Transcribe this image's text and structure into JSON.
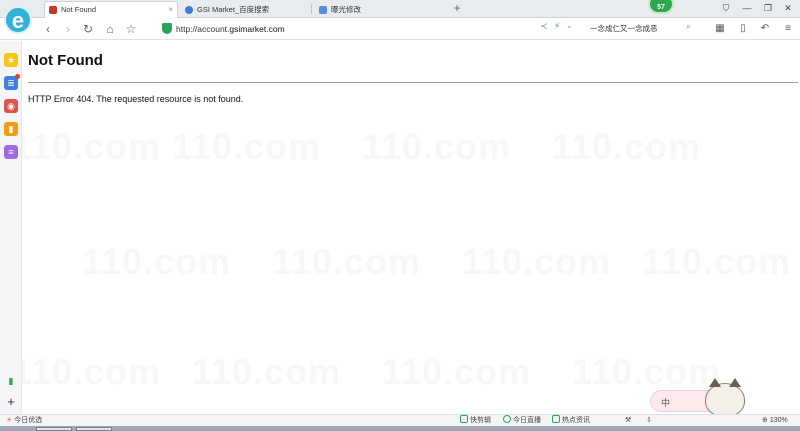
{
  "tabs": [
    {
      "label": "Not Found",
      "active": true
    },
    {
      "label": "GSI Market_百度搜索",
      "active": false
    },
    {
      "label": "曝光修改",
      "active": false
    }
  ],
  "badge_count": "57",
  "address": {
    "prefix": "http://account.",
    "host": "gsimarket.com"
  },
  "search": {
    "text": "一念成仁又一念成恶"
  },
  "page": {
    "title": "Not Found",
    "message": "HTTP Error 404. The requested resource is not found."
  },
  "watermark": "110.com",
  "ime": {
    "label": "中"
  },
  "statusbar": {
    "left_label": "今日优选",
    "items": [
      "快剪辑",
      "今日直播",
      "热点资讯"
    ],
    "zoom": "130%"
  },
  "colors": {
    "logo": "#33b1d6",
    "accent_green": "#2ea84f",
    "badge": "#2ea84f"
  }
}
